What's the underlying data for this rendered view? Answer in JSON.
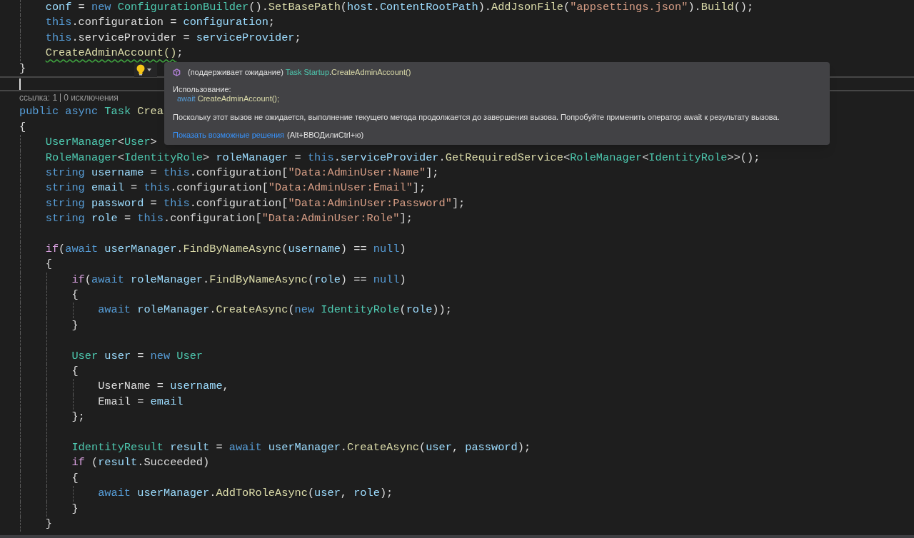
{
  "code_before": [
    {
      "current": false,
      "tokens": [
        {
          "kind": "variable",
          "text": "    conf"
        },
        {
          "kind": "plain",
          "text": " = "
        },
        {
          "kind": "keyword",
          "text": "new "
        },
        {
          "kind": "type",
          "text": "ConfigurationBuilder"
        },
        {
          "kind": "plain",
          "text": "()."
        },
        {
          "kind": "method",
          "text": "SetBasePath"
        },
        {
          "kind": "plain",
          "text": "("
        },
        {
          "kind": "variable",
          "text": "host"
        },
        {
          "kind": "plain",
          "text": "."
        },
        {
          "kind": "variable",
          "text": "ContentRootPath"
        },
        {
          "kind": "plain",
          "text": ")."
        },
        {
          "kind": "method",
          "text": "AddJsonFile"
        },
        {
          "kind": "plain",
          "text": "("
        },
        {
          "kind": "string",
          "text": "\"appsettings.json\""
        },
        {
          "kind": "plain",
          "text": ")."
        },
        {
          "kind": "method",
          "text": "Build"
        },
        {
          "kind": "plain",
          "text": "();"
        }
      ]
    },
    {
      "current": false,
      "tokens": [
        {
          "kind": "keyword",
          "text": "    this"
        },
        {
          "kind": "plain",
          "text": ".configuration = "
        },
        {
          "kind": "variable",
          "text": "configuration"
        },
        {
          "kind": "plain",
          "text": ";"
        }
      ]
    },
    {
      "current": false,
      "tokens": [
        {
          "kind": "keyword",
          "text": "    this"
        },
        {
          "kind": "plain",
          "text": ".serviceProvider = "
        },
        {
          "kind": "variable",
          "text": "serviceProvider"
        },
        {
          "kind": "plain",
          "text": ";"
        }
      ]
    },
    {
      "current": false,
      "tokens": [
        {
          "kind": "warning",
          "text": "    CreateAdminAccount()"
        },
        {
          "kind": "plain",
          "text": ";"
        }
      ]
    },
    {
      "current": false,
      "tokens": [
        {
          "kind": "plain",
          "text": "}"
        }
      ]
    },
    {
      "current": true
    }
  ],
  "codelens": {
    "references": "ссылка: 1",
    "exceptions": "0 исключения"
  },
  "code_after": [
    {
      "current": false,
      "tokens": [
        {
          "kind": "keyword",
          "text": "public async "
        },
        {
          "kind": "type",
          "text": "Task "
        },
        {
          "kind": "method",
          "text": "Crea"
        }
      ]
    },
    {
      "current": false,
      "tokens": [
        {
          "kind": "plain",
          "text": "{"
        }
      ]
    },
    {
      "current": false,
      "tokens": [
        {
          "kind": "type",
          "text": "    UserManager"
        },
        {
          "kind": "plain",
          "text": "<"
        },
        {
          "kind": "type",
          "text": "User"
        },
        {
          "kind": "plain",
          "text": ">"
        }
      ]
    },
    {
      "current": false,
      "tokens": [
        {
          "kind": "type",
          "text": "    RoleManager"
        },
        {
          "kind": "plain",
          "text": "<"
        },
        {
          "kind": "type",
          "text": "IdentityRole"
        },
        {
          "kind": "plain",
          "text": "> "
        },
        {
          "kind": "variable",
          "text": "roleManager"
        },
        {
          "kind": "plain",
          "text": " = "
        },
        {
          "kind": "keyword",
          "text": "this"
        },
        {
          "kind": "plain",
          "text": "."
        },
        {
          "kind": "variable",
          "text": "serviceProvider"
        },
        {
          "kind": "plain",
          "text": "."
        },
        {
          "kind": "method",
          "text": "GetRequiredService"
        },
        {
          "kind": "plain",
          "text": "<"
        },
        {
          "kind": "type",
          "text": "RoleManager"
        },
        {
          "kind": "plain",
          "text": "<"
        },
        {
          "kind": "type",
          "text": "IdentityRole"
        },
        {
          "kind": "plain",
          "text": ">>();"
        }
      ]
    },
    {
      "current": false,
      "tokens": [
        {
          "kind": "keyword",
          "text": "    string "
        },
        {
          "kind": "variable",
          "text": "username"
        },
        {
          "kind": "plain",
          "text": " = "
        },
        {
          "kind": "keyword",
          "text": "this"
        },
        {
          "kind": "plain",
          "text": ".configuration["
        },
        {
          "kind": "string",
          "text": "\"Data:AdminUser:Name\""
        },
        {
          "kind": "plain",
          "text": "];"
        }
      ]
    },
    {
      "current": false,
      "tokens": [
        {
          "kind": "keyword",
          "text": "    string "
        },
        {
          "kind": "variable",
          "text": "email"
        },
        {
          "kind": "plain",
          "text": " = "
        },
        {
          "kind": "keyword",
          "text": "this"
        },
        {
          "kind": "plain",
          "text": ".configuration["
        },
        {
          "kind": "string",
          "text": "\"Data:AdminUser:Email\""
        },
        {
          "kind": "plain",
          "text": "];"
        }
      ]
    },
    {
      "current": false,
      "tokens": [
        {
          "kind": "keyword",
          "text": "    string "
        },
        {
          "kind": "variable",
          "text": "password"
        },
        {
          "kind": "plain",
          "text": " = "
        },
        {
          "kind": "keyword",
          "text": "this"
        },
        {
          "kind": "plain",
          "text": ".configuration["
        },
        {
          "kind": "string",
          "text": "\"Data:AdminUser:Password\""
        },
        {
          "kind": "plain",
          "text": "];"
        }
      ]
    },
    {
      "current": false,
      "tokens": [
        {
          "kind": "keyword",
          "text": "    string "
        },
        {
          "kind": "variable",
          "text": "role"
        },
        {
          "kind": "plain",
          "text": " = "
        },
        {
          "kind": "keyword",
          "text": "this"
        },
        {
          "kind": "plain",
          "text": ".configuration["
        },
        {
          "kind": "string",
          "text": "\"Data:AdminUser:Role\""
        },
        {
          "kind": "plain",
          "text": "];"
        }
      ]
    },
    {
      "current": false
    },
    {
      "current": false,
      "tokens": [
        {
          "kind": "control",
          "text": "    if"
        },
        {
          "kind": "plain",
          "text": "("
        },
        {
          "kind": "keyword",
          "text": "await "
        },
        {
          "kind": "variable",
          "text": "userManager"
        },
        {
          "kind": "plain",
          "text": "."
        },
        {
          "kind": "method",
          "text": "FindByNameAsync"
        },
        {
          "kind": "plain",
          "text": "("
        },
        {
          "kind": "variable",
          "text": "username"
        },
        {
          "kind": "plain",
          "text": ") == "
        },
        {
          "kind": "keyword",
          "text": "null"
        },
        {
          "kind": "plain",
          "text": ")"
        }
      ]
    },
    {
      "current": false,
      "tokens": [
        {
          "kind": "plain",
          "text": "    {"
        }
      ]
    },
    {
      "current": false,
      "tokens": [
        {
          "kind": "control",
          "text": "        if"
        },
        {
          "kind": "plain",
          "text": "("
        },
        {
          "kind": "keyword",
          "text": "await "
        },
        {
          "kind": "variable",
          "text": "roleManager"
        },
        {
          "kind": "plain",
          "text": "."
        },
        {
          "kind": "method",
          "text": "FindByNameAsync"
        },
        {
          "kind": "plain",
          "text": "("
        },
        {
          "kind": "variable",
          "text": "role"
        },
        {
          "kind": "plain",
          "text": ") == "
        },
        {
          "kind": "keyword",
          "text": "null"
        },
        {
          "kind": "plain",
          "text": ")"
        }
      ]
    },
    {
      "current": false,
      "tokens": [
        {
          "kind": "plain",
          "text": "        {"
        }
      ]
    },
    {
      "current": false,
      "tokens": [
        {
          "kind": "keyword",
          "text": "            await "
        },
        {
          "kind": "variable",
          "text": "roleManager"
        },
        {
          "kind": "plain",
          "text": "."
        },
        {
          "kind": "method",
          "text": "CreateAsync"
        },
        {
          "kind": "plain",
          "text": "("
        },
        {
          "kind": "keyword",
          "text": "new "
        },
        {
          "kind": "type",
          "text": "IdentityRole"
        },
        {
          "kind": "plain",
          "text": "("
        },
        {
          "kind": "variable",
          "text": "role"
        },
        {
          "kind": "plain",
          "text": "));"
        }
      ]
    },
    {
      "current": false,
      "tokens": [
        {
          "kind": "plain",
          "text": "        }"
        }
      ]
    },
    {
      "current": false
    },
    {
      "current": false,
      "tokens": [
        {
          "kind": "type",
          "text": "        User "
        },
        {
          "kind": "variable",
          "text": "user"
        },
        {
          "kind": "plain",
          "text": " = "
        },
        {
          "kind": "keyword",
          "text": "new "
        },
        {
          "kind": "type",
          "text": "User"
        }
      ]
    },
    {
      "current": false,
      "tokens": [
        {
          "kind": "plain",
          "text": "        {"
        }
      ]
    },
    {
      "current": false,
      "tokens": [
        {
          "kind": "plain",
          "text": "            UserName = "
        },
        {
          "kind": "variable",
          "text": "username"
        },
        {
          "kind": "plain",
          "text": ","
        }
      ]
    },
    {
      "current": false,
      "tokens": [
        {
          "kind": "plain",
          "text": "            Email = "
        },
        {
          "kind": "variable",
          "text": "email"
        }
      ]
    },
    {
      "current": false,
      "tokens": [
        {
          "kind": "plain",
          "text": "        };"
        }
      ]
    },
    {
      "current": false
    },
    {
      "current": false,
      "tokens": [
        {
          "kind": "type",
          "text": "        IdentityResult "
        },
        {
          "kind": "variable",
          "text": "result"
        },
        {
          "kind": "plain",
          "text": " = "
        },
        {
          "kind": "keyword",
          "text": "await "
        },
        {
          "kind": "variable",
          "text": "userManager"
        },
        {
          "kind": "plain",
          "text": "."
        },
        {
          "kind": "method",
          "text": "CreateAsync"
        },
        {
          "kind": "plain",
          "text": "("
        },
        {
          "kind": "variable",
          "text": "user"
        },
        {
          "kind": "plain",
          "text": ", "
        },
        {
          "kind": "variable",
          "text": "password"
        },
        {
          "kind": "plain",
          "text": ");"
        }
      ]
    },
    {
      "current": false,
      "tokens": [
        {
          "kind": "control",
          "text": "        if"
        },
        {
          "kind": "plain",
          "text": " ("
        },
        {
          "kind": "variable",
          "text": "result"
        },
        {
          "kind": "plain",
          "text": ".Succeeded)"
        }
      ]
    },
    {
      "current": false,
      "tokens": [
        {
          "kind": "plain",
          "text": "        {"
        }
      ]
    },
    {
      "current": false,
      "tokens": [
        {
          "kind": "keyword",
          "text": "            await "
        },
        {
          "kind": "variable",
          "text": "userManager"
        },
        {
          "kind": "plain",
          "text": "."
        },
        {
          "kind": "method",
          "text": "AddToRoleAsync"
        },
        {
          "kind": "plain",
          "text": "("
        },
        {
          "kind": "variable",
          "text": "user"
        },
        {
          "kind": "plain",
          "text": ", "
        },
        {
          "kind": "variable",
          "text": "role"
        },
        {
          "kind": "plain",
          "text": ");"
        }
      ]
    },
    {
      "current": false,
      "tokens": [
        {
          "kind": "plain",
          "text": "        }"
        }
      ]
    },
    {
      "current": false,
      "tokens": [
        {
          "kind": "plain",
          "text": "    }"
        }
      ]
    }
  ],
  "quick_info": {
    "signature": [
      {
        "kind": "plain",
        "text": "(поддерживает ожидание) "
      },
      {
        "kind": "type",
        "text": "Task Startup"
      },
      {
        "kind": "plain",
        "text": "."
      },
      {
        "kind": "method",
        "text": "CreateAdminAccount()"
      }
    ],
    "usage_label": "Использование:",
    "usage_code": [
      {
        "kind": "keyword",
        "text": "await "
      },
      {
        "kind": "method",
        "text": "CreateAdminAccount();"
      }
    ],
    "description": "Поскольку этот вызов не ожидается, выполнение текущего метода продолжается до завершения вызова. Попробуйте применить оператор await к результату вызова.",
    "link": "Показать возможные решения",
    "shortcut": "(Alt+ВВОДилиCtrl+ю)"
  }
}
